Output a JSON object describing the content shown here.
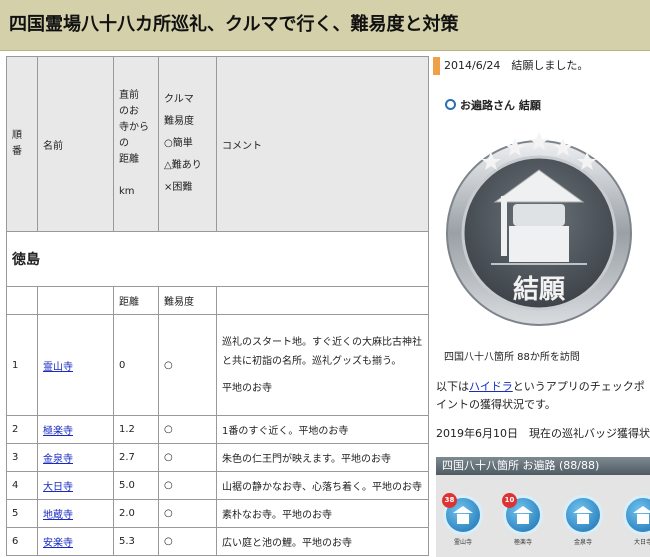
{
  "page": {
    "title": "四国霊場八十八カ所巡礼、クルマで行く、難易度と対策"
  },
  "table": {
    "header": {
      "order": "順番",
      "name": "名前",
      "distance_lines": [
        "直前",
        "のお",
        "寺から",
        "の",
        "距離",
        "",
        "km"
      ],
      "difficulty_lines": [
        "クルマ",
        "難易度",
        "○簡単",
        "△難あり",
        "×困難"
      ],
      "comment": "コメント"
    },
    "region": "徳島",
    "subheader": {
      "distance": "距離",
      "difficulty": "難易度"
    },
    "rows": [
      {
        "order": "1",
        "name": "霊山寺",
        "distance": "0",
        "difficulty": "○",
        "comment": "巡礼のスタート地。すぐ近くの大麻比古神社と共に初詣の名所。巡礼グッズも揃う。",
        "comment2": "平地のお寺"
      },
      {
        "order": "2",
        "name": "極楽寺",
        "distance": "1.2",
        "difficulty": "○",
        "comment": "1番のすぐ近く。平地のお寺"
      },
      {
        "order": "3",
        "name": "金泉寺",
        "distance": "2.7",
        "difficulty": "○",
        "comment": "朱色の仁王門が映えます。平地のお寺"
      },
      {
        "order": "4",
        "name": "大日寺",
        "distance": "5.0",
        "difficulty": "○",
        "comment": "山裾の静かなお寺、心落ち着く。平地のお寺"
      },
      {
        "order": "5",
        "name": "地蔵寺",
        "distance": "2.0",
        "difficulty": "○",
        "comment": "素朴なお寺。平地のお寺"
      },
      {
        "order": "6",
        "name": "安楽寺",
        "distance": "5.3",
        "difficulty": "○",
        "comment": "広い庭と池の鯉。平地のお寺"
      }
    ]
  },
  "sidebar": {
    "news": "2014/6/24　結願しました。",
    "henro_title": "お遍路さん 結願",
    "medal_text": "結願",
    "medal_caption": "四国八十八箇所 88か所を訪問",
    "para_prefix": "以下は",
    "para_link": "ハイドラ",
    "para_suffix": "というアプリのチェックポイントの獲得状況です。",
    "date_line": "2019年6月10日　現在の巡礼バッジ獲得状況",
    "badge_bar": "四国八十八箇所 お遍路 (88/88)",
    "badges": [
      {
        "num": "38",
        "label": "霊山寺"
      },
      {
        "num": "10",
        "label": "極楽寺"
      },
      {
        "num": "",
        "label": "金泉寺"
      },
      {
        "num": "",
        "label": "大日寺"
      }
    ],
    "colors": {
      "accent": "#f0a048",
      "title_bg": "#d3d0aa",
      "link": "#1a2bc0",
      "badge": "#1a6fb0"
    }
  }
}
